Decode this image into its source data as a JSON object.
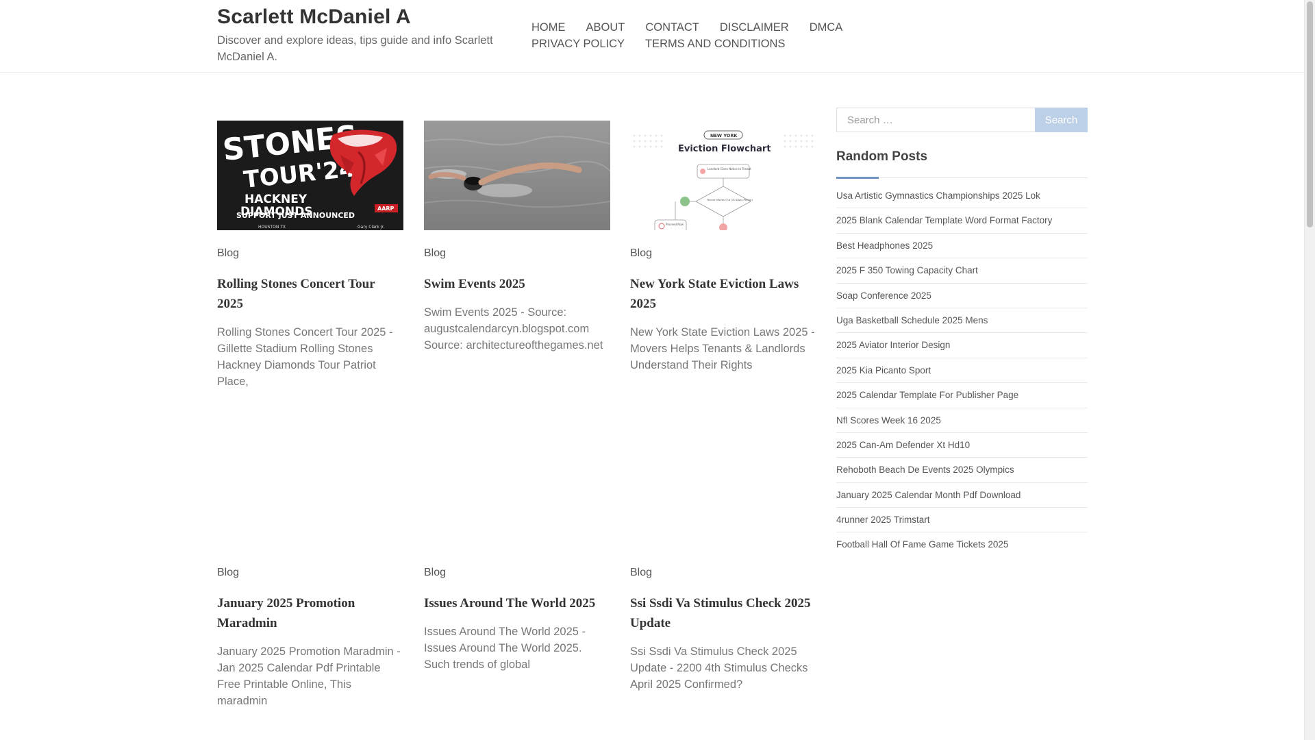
{
  "site": {
    "title": "Scarlett McDaniel A",
    "description": "Discover and explore ideas, tips guide and info Scarlett McDaniel A."
  },
  "nav": {
    "items": [
      "HOME",
      "ABOUT",
      "CONTACT",
      "DISCLAIMER",
      "DMCA",
      "PRIVACY POLICY",
      "TERMS AND CONDITIONS"
    ]
  },
  "posts": [
    {
      "category": "Blog",
      "title": "Rolling Stones Concert Tour 2025",
      "excerpt": "Rolling Stones Concert Tour 2025 - Gillette Stadium Rolling Stones Hackney Diamonds Tour Patriot Place,",
      "thumb_text": {
        "line1": "STONES",
        "line2": "TOUR'24",
        "line3": "HACKNEY",
        "line4": "DIAMONDS",
        "line5": "SUPPORT JUST ANNOUNCED",
        "badge": "AARP",
        "footer_left": "HOUSTON TX",
        "footer_right": "Gary Clark Jr."
      }
    },
    {
      "category": "Blog",
      "title": "Swim Events 2025",
      "excerpt": "Swim Events 2025 - Source: augustcalendarcyn.blogspot.com Source: architectureofthegames.net"
    },
    {
      "category": "Blog",
      "title": "New York State Eviction Laws 2025",
      "excerpt": "New York State Eviction Laws 2025 - Movers Helps Tenants & Landlords Understand Their Rights",
      "thumb_text": {
        "tag": "NEW YORK",
        "heading": "Eviction Flowchart",
        "box1": "Landlord Gives Notice to Tenant",
        "box2": "Tenant Moves Out (20 Days Period)",
        "box3": "Proceed Now"
      }
    },
    {
      "category": "Blog",
      "title": "January 2025 Promotion Maradmin",
      "excerpt": "January 2025 Promotion Maradmin - Jan 2025 Calendar Pdf Printable Free Printable Online, This maradmin"
    },
    {
      "category": "Blog",
      "title": "Issues Around The World 2025",
      "excerpt": "Issues Around The World 2025 - Issues Around The World 2025. Such trends of global"
    },
    {
      "category": "Blog",
      "title": "Ssi Ssdi Va Stimulus Check 2025 Update",
      "excerpt": "Ssi Ssdi Va Stimulus Check 2025 Update - 2200 4th Stimulus Checks April 2025 Confirmed?"
    }
  ],
  "sidebar": {
    "search_placeholder": "Search …",
    "search_button": "Search",
    "random_title": "Random Posts",
    "random_posts": [
      "Usa Artistic Gymnastics Championships 2025 Lok",
      "2025 Blank Calendar Template Word Format Factory",
      "Best Headphones 2025",
      "2025 F 350 Towing Capacity Chart",
      "Soap Conference 2025",
      "Uga Basketball Schedule 2025 Mens",
      "2025 Aviator Interior Design",
      "2025 Kia Picanto Sport",
      "2025 Calendar Template For Publisher Page",
      "Nfl Scores Week 16 2025",
      "2025 Can-Am Defender Xt Hd10",
      "Rehoboth Beach De Events 2025 Olympics",
      "January 2025 Calendar Month Pdf Download",
      "4runner 2025 Trimstart",
      "Football Hall Of Fame Game Tickets 2025"
    ]
  },
  "colors": {
    "accent": "#6f93c3",
    "search_button_bg": "#bcd0e8",
    "stones_bg": "#1b1b1b",
    "swim_water": "#8d8d8d"
  }
}
